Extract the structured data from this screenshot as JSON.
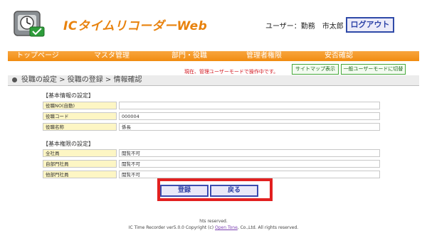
{
  "header": {
    "app_title": "ICタイムリコーダーWeb",
    "user_label": "ユーザー：勤務　市太郎",
    "logout_label": "ログアウト"
  },
  "nav": {
    "items": [
      {
        "label": "トップページ"
      },
      {
        "label": "マスタ管理"
      },
      {
        "label": "部門・役職"
      },
      {
        "label": "管理者権限"
      },
      {
        "label": "安否確認"
      }
    ]
  },
  "notice": "現在、管理ユーザーモードで操作中です。",
  "buttons": {
    "sitemap": "サイトマップ表示",
    "switch_mode": "一般ユーザーモードに切替"
  },
  "breadcrumb": "役職の設定 > 役職の登録 > 情報確認",
  "basic_info": {
    "title": "【基本情報の設定】",
    "rows": [
      {
        "label": "役職NO(自動)",
        "value": ""
      },
      {
        "label": "役職コード",
        "value": "000004"
      },
      {
        "label": "役職名称",
        "value": "係長"
      }
    ]
  },
  "basic_perm": {
    "title": "【基本権限の設定】",
    "rows": [
      {
        "label": "全社員",
        "value": "閲覧不可"
      },
      {
        "label": "自部門社員",
        "value": "閲覧不可"
      },
      {
        "label": "他部門社員",
        "value": "閲覧不可"
      }
    ]
  },
  "actions": {
    "register": "登録",
    "back": "戻る"
  },
  "footer": {
    "line1": "hts reserved.",
    "line2_prefix": "IC Time Recorder ver5.0.0 Copyright (c) ",
    "link": "Open Tone",
    "line2_suffix": ", Co.,Ltd. All rights reserved."
  },
  "colors": {
    "nav": "#f18c10",
    "accent": "#e8820d",
    "highlight": "#e22020",
    "button_border": "#3a4bb0"
  }
}
